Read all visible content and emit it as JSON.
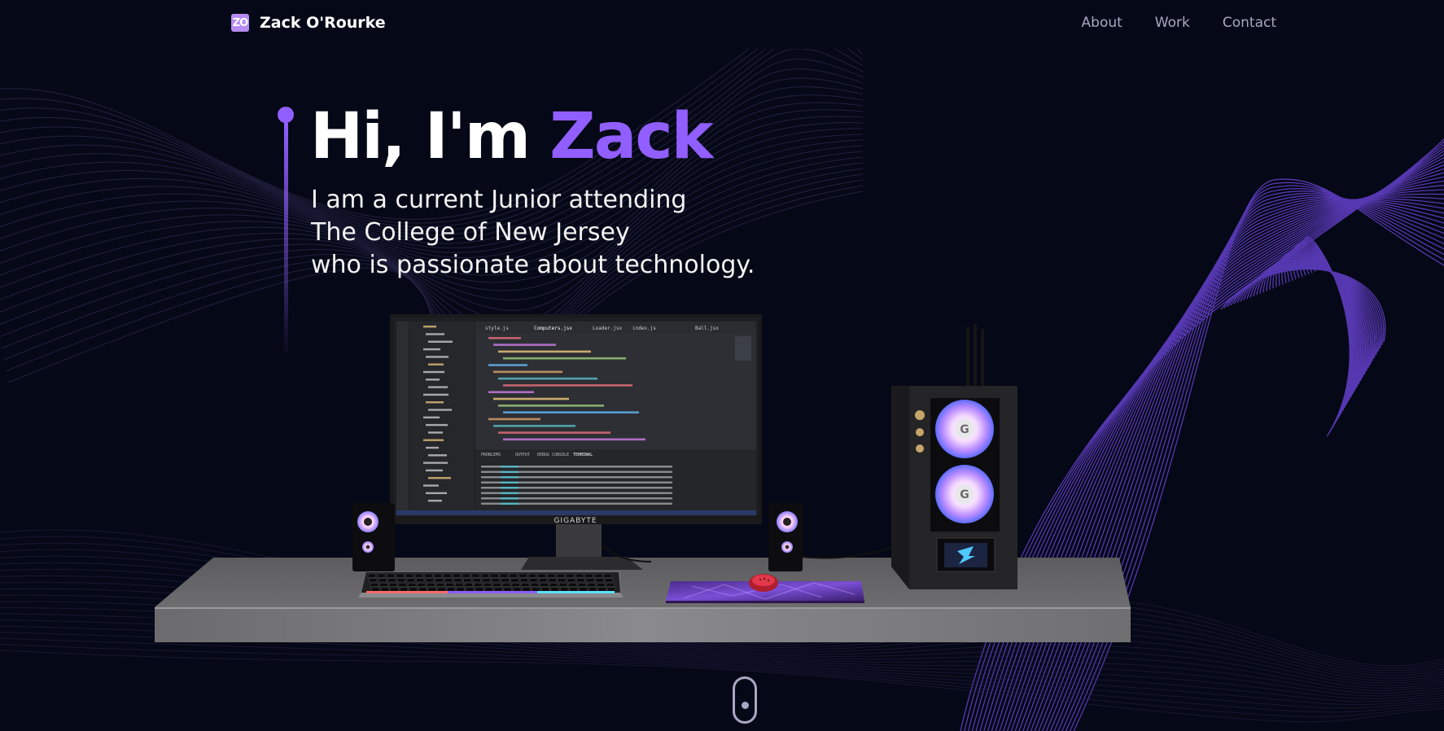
{
  "nav": {
    "logo_mark": "ZO",
    "brand_name": "Zack O'Rourke",
    "links": [
      "About",
      "Work",
      "Contact"
    ]
  },
  "hero": {
    "greeting": "Hi, I'm ",
    "name": "Zack",
    "subtitle_lines": [
      "I am a current Junior attending",
      "The College of New Jersey",
      "who is passionate about technology."
    ]
  },
  "monitor": {
    "brand": "GIGABYTE",
    "editor_tabs": [
      "style.js",
      "Computers.jsx",
      "Loader.jsx",
      "index.js",
      "Ball.jsx"
    ],
    "panel_tabs": [
      "PROBLEMS",
      "OUTPUT",
      "DEBUG CONSOLE",
      "TERMINAL"
    ]
  },
  "scroll_indicator": {
    "icon": "mouse-scroll-icon"
  },
  "colors": {
    "background": "#050816",
    "accent": "#915eff",
    "nav_link": "#aaa6c3"
  }
}
